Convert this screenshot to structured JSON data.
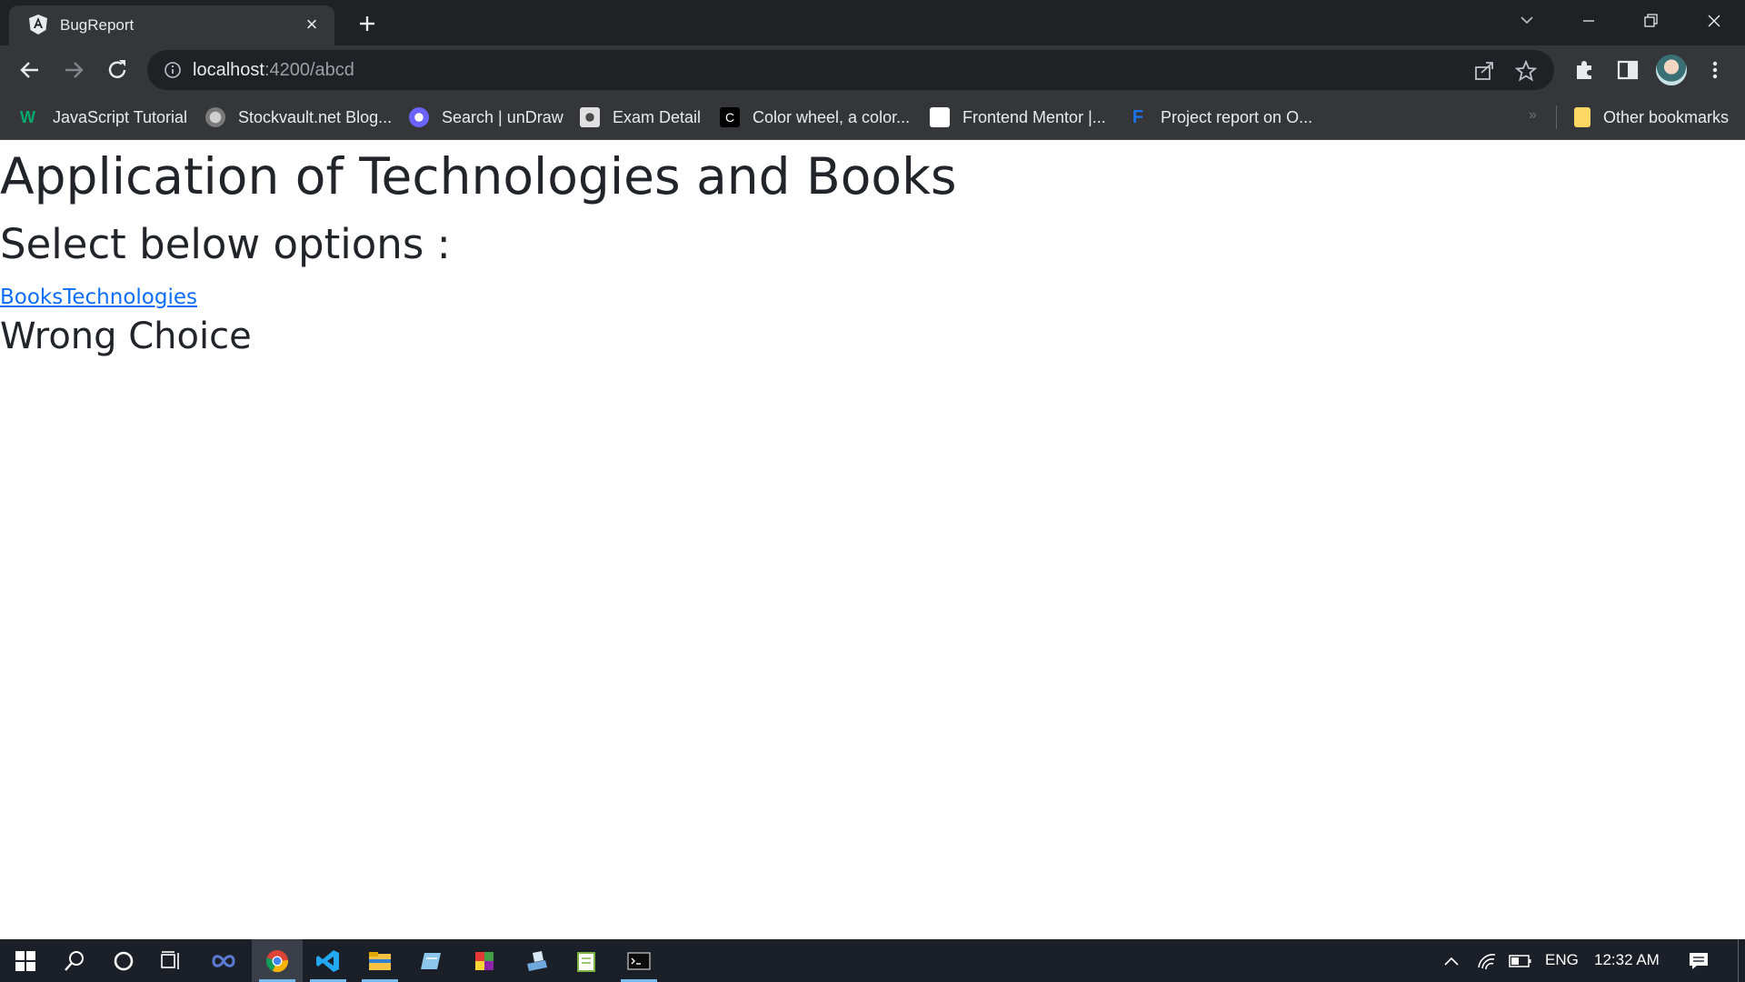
{
  "browser": {
    "tab": {
      "title": "BugReport",
      "favicon": "angular-icon"
    },
    "address": {
      "host": "localhost",
      "path": ":4200/abcd"
    },
    "bookmarks": [
      {
        "label": "JavaScript Tutorial",
        "icon": "w3schools-icon",
        "color": "#04aa6d"
      },
      {
        "label": "Stockvault.net Blog...",
        "icon": "stockvault-icon",
        "color": "#9aa0a6"
      },
      {
        "label": "Search | unDraw",
        "icon": "undraw-icon",
        "color": "#6c63ff"
      },
      {
        "label": "Exam Detail",
        "icon": "exam-icon",
        "color": "#d0d0d0"
      },
      {
        "label": "Color wheel, a color...",
        "icon": "color-wheel-icon",
        "color": "#111111"
      },
      {
        "label": "Frontend Mentor |...",
        "icon": "frontend-mentor-icon",
        "color": "#ffffff"
      },
      {
        "label": "Project report on O...",
        "icon": "project-report-icon",
        "color": "#1a73e8"
      }
    ],
    "other_bookmarks": "Other bookmarks"
  },
  "page": {
    "title": "Application of Technologies and Books",
    "subtitle": "Select below options :",
    "links": [
      "Books",
      "Technologies"
    ],
    "message": "Wrong Choice"
  },
  "taskbar": {
    "language": "ENG",
    "time": "12:32 AM"
  },
  "colors": {
    "link": "#0d6efd",
    "text": "#212529",
    "chrome_bg": "#35363a",
    "tabstrip_bg": "#202124",
    "taskbar_bg": "#1b1f27"
  }
}
